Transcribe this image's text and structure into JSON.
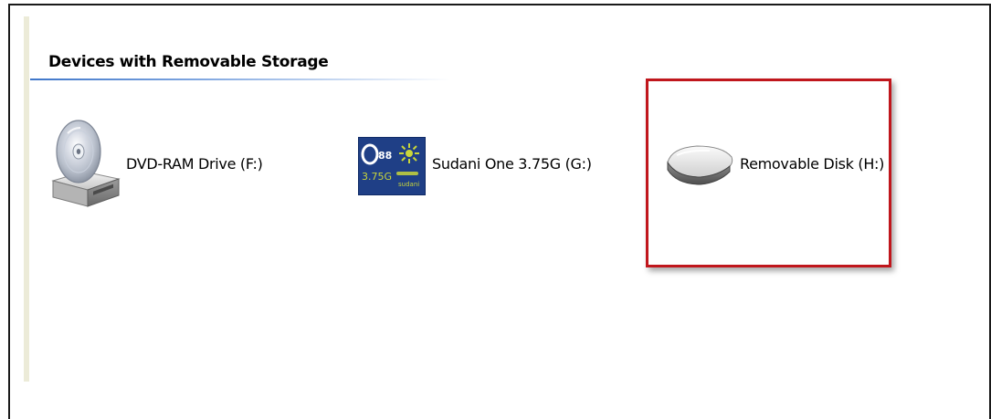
{
  "group": {
    "title": "Devices with Removable Storage"
  },
  "devices": [
    {
      "label": "DVD-RAM Drive (F:)",
      "icon": "dvd-drive-icon"
    },
    {
      "label": "Sudani One 3.75G (G:)",
      "icon": "sudani-modem-icon"
    },
    {
      "label": "Removable Disk (H:)",
      "icon": "removable-disk-icon",
      "highlighted": true
    }
  ],
  "sudani_icon": {
    "text_top": "O",
    "text_speed": "3.75G",
    "brand_small": "sudani"
  },
  "colors": {
    "highlight_border": "#c0161c",
    "header_rule": "#3f76c9",
    "sudani_background": "#1f3f86",
    "sudani_accent": "#c9d63a"
  }
}
